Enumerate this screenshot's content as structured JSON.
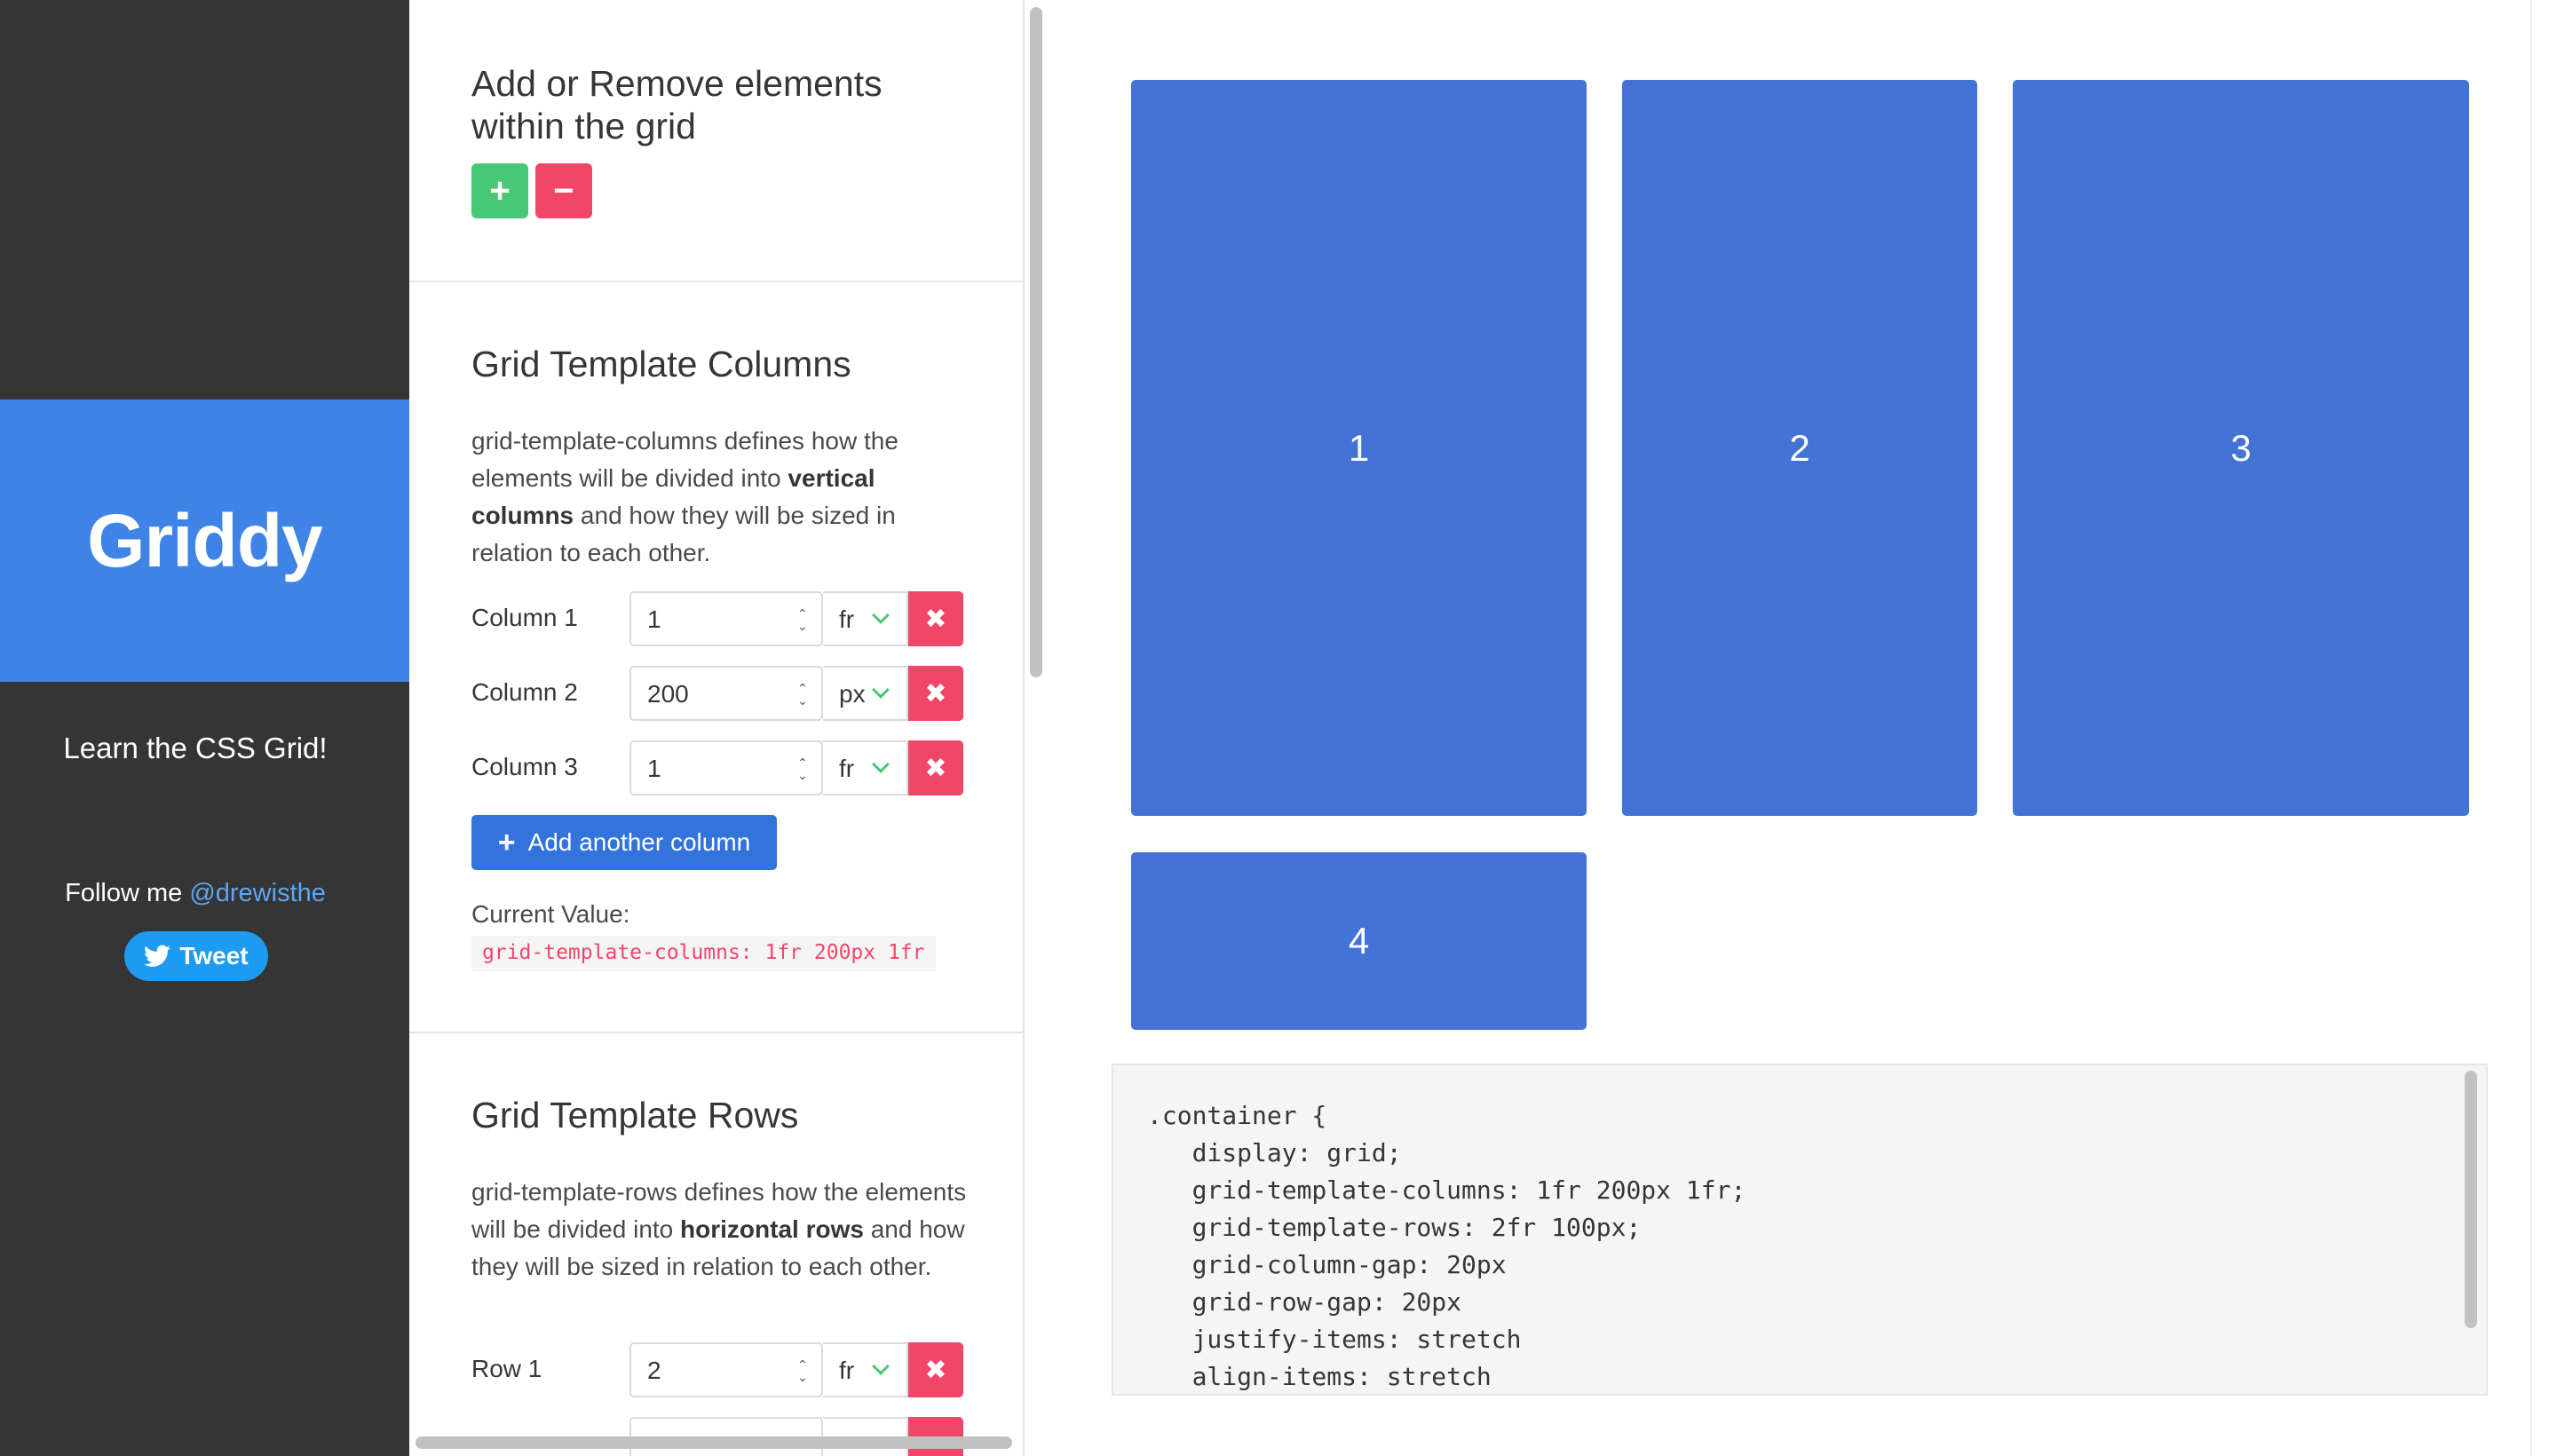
{
  "sidebar": {
    "brand": "Griddy",
    "tagline": "Learn the CSS Grid!",
    "follow_text": "Follow me",
    "follow_handle": "@drewisthe",
    "tweet_label": "Tweet"
  },
  "add_remove": {
    "title_line1": "Add or Remove elements",
    "title_line2": "within the grid",
    "add_label": "+",
    "remove_label": "−"
  },
  "columns_section": {
    "title": "Grid Template Columns",
    "desc_prefix": "grid-template-columns defines how the elements will be divided into ",
    "desc_bold": "vertical columns",
    "desc_suffix": " and how they will be sized in relation to each other.",
    "rows": [
      {
        "label": "Column 1",
        "value": "1",
        "unit": "fr"
      },
      {
        "label": "Column 2",
        "value": "200",
        "unit": "px"
      },
      {
        "label": "Column 3",
        "value": "1",
        "unit": "fr"
      }
    ],
    "add_button": "Add another column",
    "current_label": "Current Value:",
    "current_value": "grid-template-columns: 1fr 200px 1fr"
  },
  "rows_section": {
    "title": "Grid Template Rows",
    "desc_prefix": "grid-template-rows defines how the elements will be divided into ",
    "desc_bold": "horizontal rows",
    "desc_suffix": " and how they will be sized in relation to each other.",
    "rows": [
      {
        "label": "Row 1",
        "value": "2",
        "unit": "fr"
      }
    ]
  },
  "grid_items": [
    "1",
    "2",
    "3",
    "4"
  ],
  "code": [
    ".container {",
    "   display: grid;",
    "   grid-template-columns: 1fr 200px 1fr;",
    "   grid-template-rows: 2fr 100px;",
    "   grid-column-gap: 20px",
    "   grid-row-gap: 20px",
    "   justify-items: stretch",
    "   align-items: stretch"
  ],
  "colors": {
    "brand": "#3f83e6",
    "cell": "#4473d6",
    "add": "#48c774",
    "danger": "#f14668",
    "primary": "#3273dc"
  }
}
